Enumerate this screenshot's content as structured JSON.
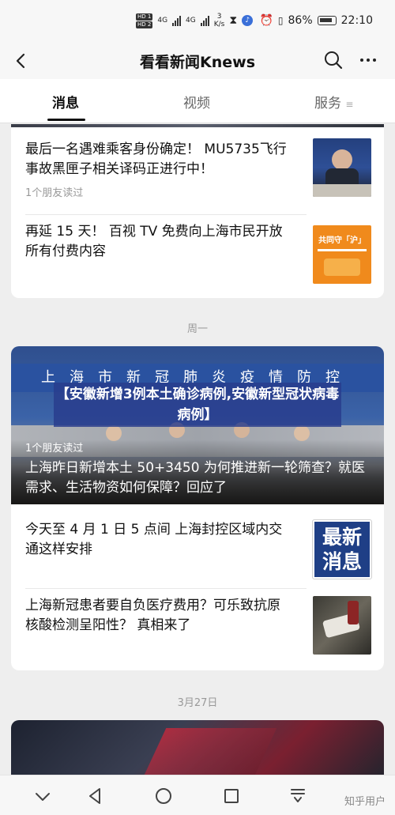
{
  "status_bar": {
    "sim1": "HD 1",
    "sim2": "HD 2",
    "net1": "4G",
    "net2": "4G",
    "speed_value": "3",
    "speed_unit": "K/s",
    "battery": "86%",
    "time": "22:10"
  },
  "header": {
    "title": "看看新闻Knews"
  },
  "tabs": [
    {
      "label": "消息",
      "active": true
    },
    {
      "label": "视频",
      "active": false
    },
    {
      "label": "服务",
      "active": false
    }
  ],
  "feed": {
    "group1": {
      "items": [
        {
          "title": "最后一名遇难乘客身份确定！ MU5735飞行事故黑匣子相关译码正进行中！",
          "meta": "1个朋友读过",
          "thumb": "press-conference-thumb"
        },
        {
          "title": "再延 15 天！ 百视 TV 免费向上海市民开放所有付费内容",
          "meta": "",
          "thumb": "orange-promo-thumb",
          "thumb_text": "共同守「沪」"
        }
      ]
    },
    "date_1": "周一",
    "group2": {
      "hero": {
        "banner_text": "上海市新冠肺炎疫情防控",
        "meta": "1个朋友读过",
        "title": "上海昨日新增本土 50+3450  为何推进新一轮筛查？就医需求、生活物资如何保障？回应了"
      },
      "items": [
        {
          "title": "今天至 4 月 1 日 5 点间 上海封控区域内交通这样安排",
          "thumb": "breaking-news-thumb",
          "thumb_line1": "最新",
          "thumb_line2": "消息"
        },
        {
          "title": "上海新冠患者要自负医疗费用？可乐致抗原核酸检测呈阳性？ 真相来了",
          "thumb": "test-kit-thumb"
        }
      ]
    },
    "date_2": "3月27日"
  },
  "overlay_caption": "【安徽新增3例本土确诊病例,安徽新型冠状病毒病例】",
  "watermark": "知乎用户",
  "colors": {
    "accent_blue": "#2a52a0",
    "promo_orange": "#f08a1c",
    "breaking_blue": "#1f3f86"
  }
}
